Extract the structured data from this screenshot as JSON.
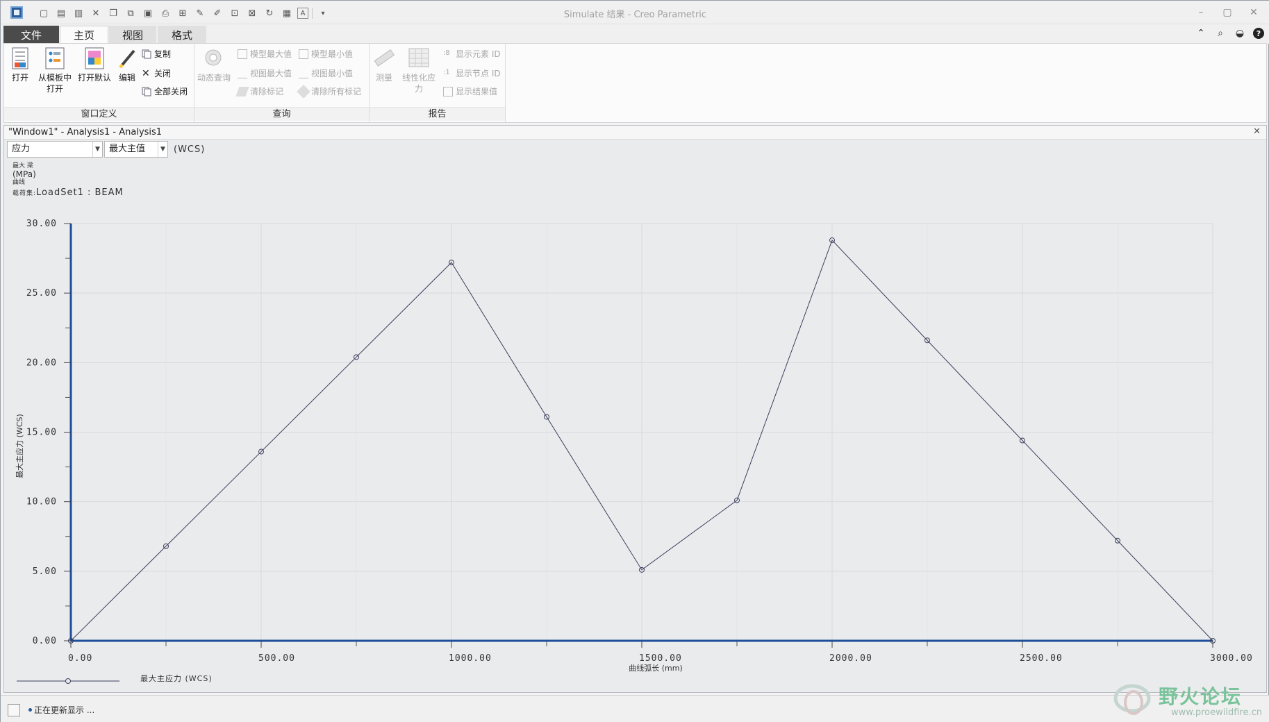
{
  "window": {
    "title": "Simulate 结果 - Creo Parametric"
  },
  "quick_access": {
    "icons": [
      "new-icon",
      "save-icon",
      "save-as-icon",
      "close-icon",
      "open-template-icon",
      "copy-icon",
      "paste-icon",
      "print-icon",
      "print-setup-icon",
      "edit-icon",
      "edit2-icon",
      "define-icon",
      "rename-icon",
      "refresh-icon",
      "window-icon",
      "text-icon",
      "more-icon"
    ]
  },
  "tabs": {
    "file": "文件",
    "home": "主页",
    "view": "视图",
    "format": "格式"
  },
  "ribbon": {
    "window_def": {
      "label": "窗口定义",
      "open": "打开",
      "open_template_l1": "从模板中",
      "open_template_l2": "打开",
      "open_default": "打开默认",
      "edit": "编辑",
      "copy": "复制",
      "close": "关闭",
      "close_all": "全部关闭"
    },
    "query": {
      "label": "查询",
      "dynamic_query": "动态查询",
      "model_max": "模型最大值",
      "model_min": "模型最小值",
      "view_max": "视图最大值",
      "view_min": "视图最小值",
      "clear_marks": "清除标记",
      "clear_all_marks": "清除所有标记"
    },
    "report": {
      "label": "报告",
      "measure": "测量",
      "linearize_l1": "线性化应",
      "linearize_l2": "力",
      "show_element_id": "显示元素 ID",
      "show_node_id": "显示节点 ID",
      "show_result_value": "显示结果值"
    }
  },
  "graph_window": {
    "title": "\"Window1\" - Analysis1 - Analysis1",
    "quantity_select": "应力",
    "component_select": "最大主值",
    "coord_label": "(WCS)",
    "header_line1": "最大  梁",
    "header_units": "(MPa)",
    "header_line3": "曲线",
    "loadset_label": "载荷集:",
    "loadset_value": "LoadSet1 :  BEAM",
    "legend_label": "最大主应力 (WCS)"
  },
  "chart_data": {
    "type": "line",
    "x": [
      0,
      250,
      500,
      750,
      1000,
      1250,
      1500,
      1750,
      2000,
      2250,
      2500,
      2750,
      3000
    ],
    "series": [
      {
        "values": [
          0,
          6.8,
          13.6,
          20.4,
          27.2,
          16.1,
          5.1,
          10.1,
          28.8,
          21.6,
          14.4,
          7.2,
          0
        ]
      }
    ],
    "xlabel": "曲线弧长 (mm)",
    "ylabel": "最大主应力 (WCS)",
    "xlim": [
      0,
      3000
    ],
    "ylim": [
      0,
      30
    ],
    "x_ticks": [
      "0.00",
      "500.00",
      "1000.00",
      "1500.00",
      "2000.00",
      "2500.00",
      "3000.00"
    ],
    "y_ticks": [
      "0.00",
      "5.00",
      "10.00",
      "15.00",
      "20.00",
      "25.00",
      "30.00"
    ],
    "grid": true,
    "colors": {
      "line": "#3a3f5c",
      "axis": "#1f4e9a",
      "grid": "#d8dadf"
    }
  },
  "status": {
    "text": "正在更新显示 ..."
  },
  "watermark": {
    "title": "野火论坛",
    "url": "www.proewildfire.cn"
  }
}
